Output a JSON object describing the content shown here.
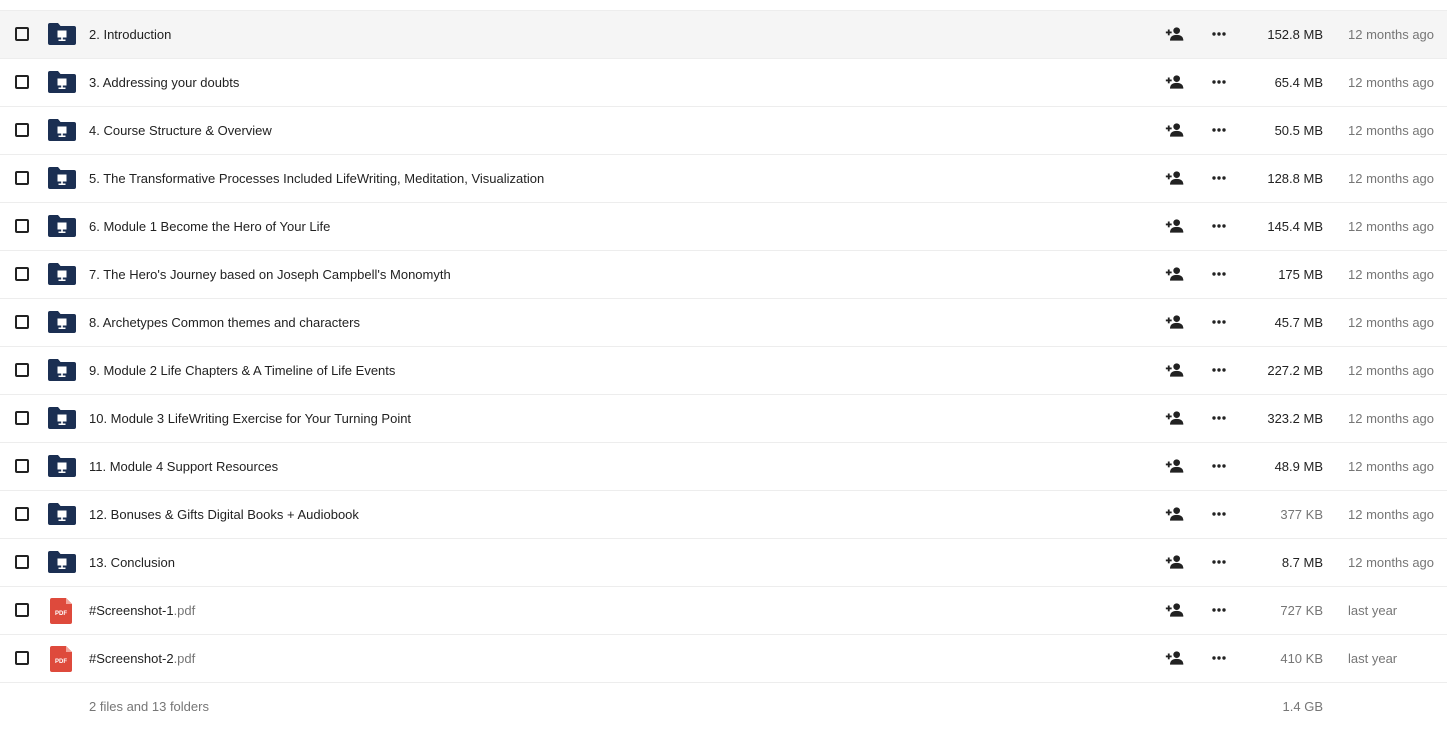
{
  "colors": {
    "folder": "#1b2f52",
    "folder_screen": "#ffffff",
    "pdf": "#de4a3c",
    "text": "#222222",
    "muted": "#767676",
    "row_highlight": "#f5f5f5"
  },
  "icons": {
    "folder": "folder-icon",
    "pdf": "pdf-file-icon",
    "share": "person-add-icon",
    "more": "more-horizontal-icon",
    "checkbox": "checkbox-icon"
  },
  "rows": [
    {
      "type": "folder",
      "name": "2. Introduction",
      "ext": "",
      "size": "152.8 MB",
      "modified": "12 months ago",
      "highlight": true
    },
    {
      "type": "folder",
      "name": "3. Addressing your doubts",
      "ext": "",
      "size": "65.4 MB",
      "modified": "12 months ago"
    },
    {
      "type": "folder",
      "name": "4. Course Structure & Overview",
      "ext": "",
      "size": "50.5 MB",
      "modified": "12 months ago"
    },
    {
      "type": "folder",
      "name": "5. The Transformative Processes Included LifeWriting, Meditation, Visualization",
      "ext": "",
      "size": "128.8 MB",
      "modified": "12 months ago"
    },
    {
      "type": "folder",
      "name": "6. Module 1 Become the Hero of Your Life",
      "ext": "",
      "size": "145.4 MB",
      "modified": "12 months ago"
    },
    {
      "type": "folder",
      "name": "7. The Hero's Journey based on Joseph Campbell's Monomyth",
      "ext": "",
      "size": "175 MB",
      "modified": "12 months ago"
    },
    {
      "type": "folder",
      "name": "8. Archetypes Common themes and characters",
      "ext": "",
      "size": "45.7 MB",
      "modified": "12 months ago"
    },
    {
      "type": "folder",
      "name": "9. Module 2 Life Chapters & A Timeline of Life Events",
      "ext": "",
      "size": "227.2 MB",
      "modified": "12 months ago"
    },
    {
      "type": "folder",
      "name": "10. Module 3 LifeWriting Exercise for Your Turning Point",
      "ext": "",
      "size": "323.2 MB",
      "modified": "12 months ago"
    },
    {
      "type": "folder",
      "name": "11. Module 4 Support Resources",
      "ext": "",
      "size": "48.9 MB",
      "modified": "12 months ago"
    },
    {
      "type": "folder",
      "name": "12. Bonuses & Gifts Digital Books + Audiobook",
      "ext": "",
      "size": "377 KB",
      "modified": "12 months ago",
      "size_muted": true
    },
    {
      "type": "folder",
      "name": "13. Conclusion",
      "ext": "",
      "size": "8.7 MB",
      "modified": "12 months ago"
    },
    {
      "type": "pdf",
      "name": "#Screenshot-1",
      "ext": ".pdf",
      "size": "727 KB",
      "modified": "last year",
      "size_muted": true,
      "pdf_label": "PDF"
    },
    {
      "type": "pdf",
      "name": "#Screenshot-2",
      "ext": ".pdf",
      "size": "410 KB",
      "modified": "last year",
      "size_muted": true,
      "pdf_label": "PDF"
    }
  ],
  "summary": {
    "text": "2 files and 13 folders",
    "size": "1.4 GB"
  }
}
